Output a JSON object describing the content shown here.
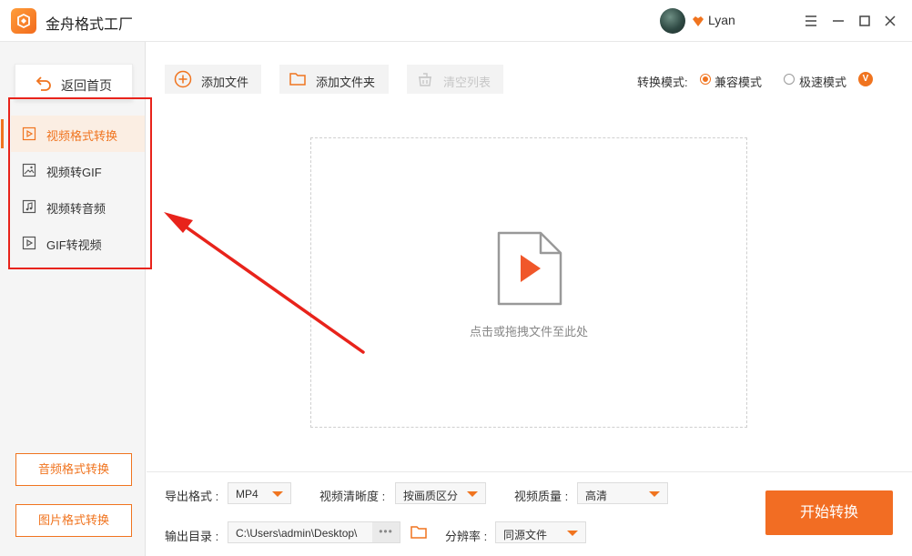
{
  "window": {
    "title": "金舟格式工厂",
    "user_name": "Lyan",
    "icons": [
      "menu-icon",
      "minimize-icon",
      "maximize-icon",
      "close-icon"
    ]
  },
  "sidebar": {
    "home_label": "返回首页",
    "items": [
      {
        "label": "视频格式转换",
        "icon": "video-play-icon",
        "active": true
      },
      {
        "label": "视频转GIF",
        "icon": "image-icon",
        "active": false
      },
      {
        "label": "视频转音频",
        "icon": "music-icon",
        "active": false
      },
      {
        "label": "GIF转视频",
        "icon": "video-play-icon",
        "active": false
      }
    ],
    "bottom_buttons": [
      "音频格式转换",
      "图片格式转换"
    ]
  },
  "toolbar": {
    "add_file": "添加文件",
    "add_folder": "添加文件夹",
    "clear_list": "清空列表",
    "mode_label": "转换模式:",
    "modes": [
      {
        "label": "兼容模式",
        "selected": true
      },
      {
        "label": "极速模式",
        "selected": false
      }
    ],
    "vip_badge": "V"
  },
  "dropzone": {
    "hint": "点击或拖拽文件至此处"
  },
  "bottom": {
    "export_format_label": "导出格式 :",
    "export_format_value": "MP4",
    "clarity_label": "视频清晰度 :",
    "clarity_value": "按画质区分",
    "quality_label": "视频质量 :",
    "quality_value": "高清",
    "output_dir_label": "输出目录 :",
    "output_dir_value": "C:\\Users\\admin\\Desktop\\",
    "output_more": "•••",
    "resolution_label": "分辨率 :",
    "resolution_value": "同源文件",
    "start_label": "开始转换"
  },
  "colors": {
    "accent": "#f0741f",
    "annotation": "#e8231b"
  }
}
